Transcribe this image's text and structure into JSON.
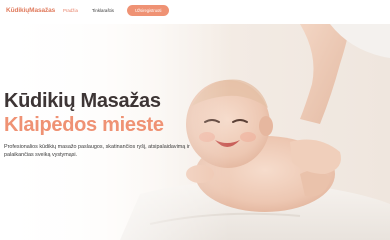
{
  "header": {
    "logo": "KūdikiųMasažas",
    "nav": [
      {
        "label": "Pradžia"
      },
      {
        "label": "Tinklaraštis"
      }
    ],
    "cta": "Užsiregistruoti"
  },
  "hero": {
    "title_line1": "Kūdikių Masažas",
    "title_line2": "Klaipėdos mieste",
    "description": "Profesionalios kūdikių masažo paslaugos, skatinančios ryšį, atsipalaidavimą ir palaikančias sveiką vystymąsi."
  },
  "colors": {
    "accent": "#ef9274",
    "logo": "#e07a5c",
    "heading": "#3d3535"
  }
}
